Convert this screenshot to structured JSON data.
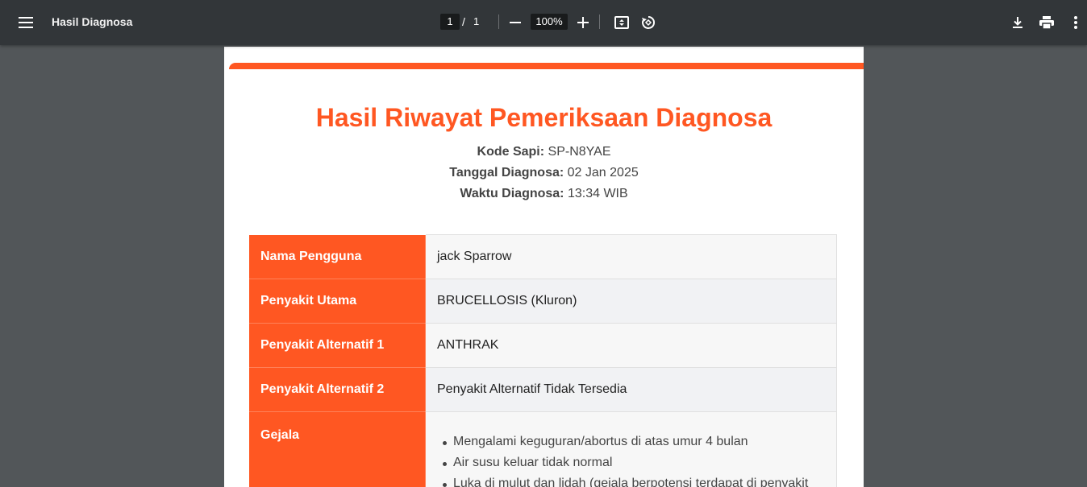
{
  "toolbar": {
    "title": "Hasil Diagnosa",
    "current_page": "1",
    "page_separator": "/",
    "total_pages": "1",
    "zoom": "100%"
  },
  "document": {
    "heading": "Hasil Riwayat Pemeriksaan Diagnosa",
    "kode_label": "Kode Sapi:",
    "kode_value": "SP-N8YAE",
    "tanggal_label": "Tanggal Diagnosa:",
    "tanggal_value": "02 Jan 2025",
    "waktu_label": "Waktu Diagnosa:",
    "waktu_value": "13:34 WIB",
    "rows": [
      {
        "label": "Nama Pengguna",
        "value": "jack Sparrow"
      },
      {
        "label": "Penyakit Utama",
        "value": "BRUCELLOSIS (Kluron)"
      },
      {
        "label": "Penyakit Alternatif 1",
        "value": "ANTHRAK"
      },
      {
        "label": "Penyakit Alternatif 2",
        "value": "Penyakit Alternatif Tidak Tersedia"
      },
      {
        "label": "Gejala",
        "value": ""
      }
    ],
    "gejala": [
      "Mengalami keguguran/abortus di atas umur 4 bulan",
      "Air susu keluar tidak normal",
      "Luka di mulut dan lidah (gejala berpotensi terdapat di penyakit"
    ]
  },
  "colors": {
    "accent": "#ff5722",
    "toolbar_bg": "#323639",
    "viewer_bg": "#525659"
  },
  "icons": [
    "menu-icon",
    "zoom-out-icon",
    "zoom-in-icon",
    "fit-page-icon",
    "rotate-icon",
    "download-icon",
    "print-icon",
    "more-vert-icon"
  ]
}
